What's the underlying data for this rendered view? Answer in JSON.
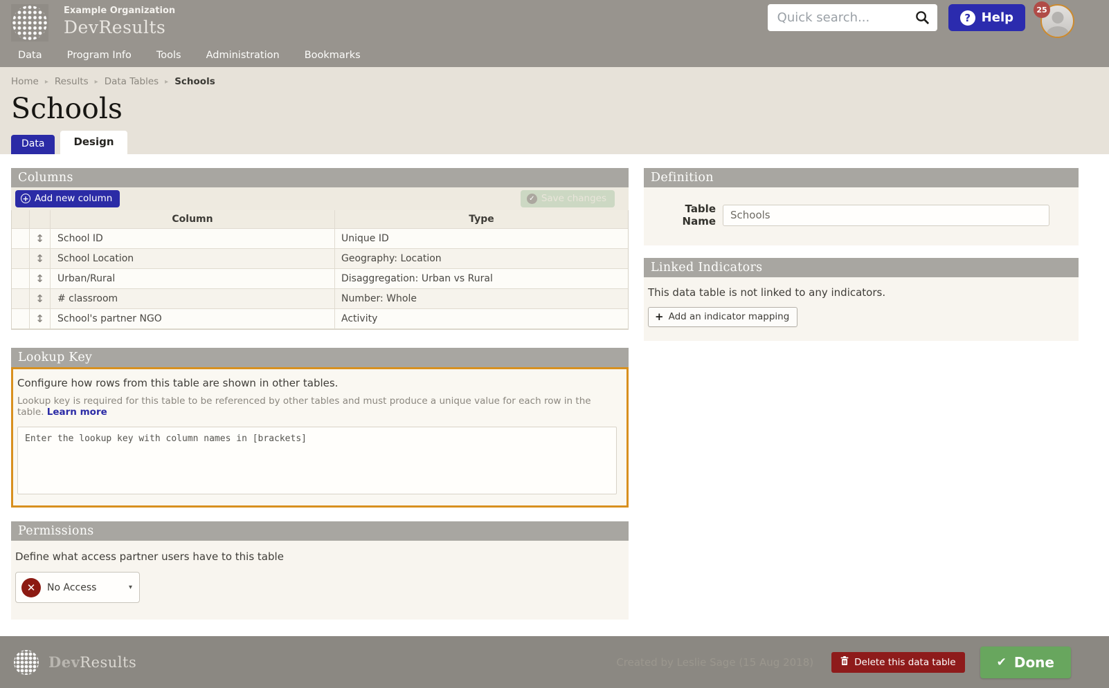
{
  "header": {
    "org_name": "Example Organization",
    "brand": "DevResults",
    "search_placeholder": "Quick search...",
    "help_label": "Help",
    "notification_count": "25"
  },
  "nav": {
    "items": [
      "Data",
      "Program Info",
      "Tools",
      "Administration",
      "Bookmarks"
    ]
  },
  "breadcrumb": {
    "items": [
      "Home",
      "Results",
      "Data Tables"
    ],
    "current": "Schools"
  },
  "page": {
    "title": "Schools",
    "tab_data": "Data",
    "tab_design": "Design"
  },
  "columns_panel": {
    "title": "Columns",
    "add_button": "Add new column",
    "save_button": "Save changes",
    "table": {
      "headers": {
        "column": "Column",
        "type": "Type"
      },
      "rows": [
        {
          "column": "School ID",
          "type": "Unique ID"
        },
        {
          "column": "School Location",
          "type": "Geography: Location"
        },
        {
          "column": "Urban/Rural",
          "type": "Disaggregation: Urban vs Rural"
        },
        {
          "column": "# classroom",
          "type": "Number: Whole"
        },
        {
          "column": "School's partner NGO",
          "type": "Activity"
        }
      ]
    }
  },
  "lookup_panel": {
    "title": "Lookup Key",
    "description": "Configure how rows from this table are shown in other tables.",
    "note": "Lookup key is required for this table to be referenced by other tables and must produce a unique value for each row in the table.",
    "learn_more": "Learn more",
    "textarea_placeholder": "Enter the lookup key with column names in [brackets]"
  },
  "permissions_panel": {
    "title": "Permissions",
    "description": "Define what access partner users have to this table",
    "selected_option": "No Access"
  },
  "definition_panel": {
    "title": "Definition",
    "table_name_label": "Table Name",
    "table_name_value": "Schools"
  },
  "linked_panel": {
    "title": "Linked Indicators",
    "empty_text": "This data table is not linked to any indicators.",
    "add_button": "Add an indicator mapping"
  },
  "footer": {
    "brand_bold": "Dev",
    "brand_rest": "Results",
    "created_by": "Created by Leslie Sage (15 Aug 2018)",
    "delete_button": "Delete this data table",
    "done_button": "Done"
  },
  "icons": {
    "globe-logo": "dotted-sphere",
    "search-icon": "magnifier",
    "help-icon": "? in white circle",
    "plus-circle-icon": "+ in circle",
    "save-check-icon": "check in circle",
    "drag-handle-icon": "↕",
    "no-access-icon": "✕ in dark red circle",
    "caret-down-icon": "▾",
    "breadcrumb-sep-icon": "▸",
    "plus-icon": "+",
    "trash-icon": "trash can",
    "done-check-icon": "✔"
  },
  "colors": {
    "header_gray": "#98948e",
    "footer_gray": "#8b8882",
    "panel_header_gray": "#a8a6a1",
    "page_beige": "#e7e2d9",
    "panel_body_beige": "#f8f5ef",
    "accent_blue": "#2b2ba6",
    "done_green": "#68a65e",
    "delete_red": "#8e1b1b",
    "no_access_red": "#8c1a12",
    "badge_red": "#b04b47",
    "highlight_orange": "#d8901f"
  }
}
